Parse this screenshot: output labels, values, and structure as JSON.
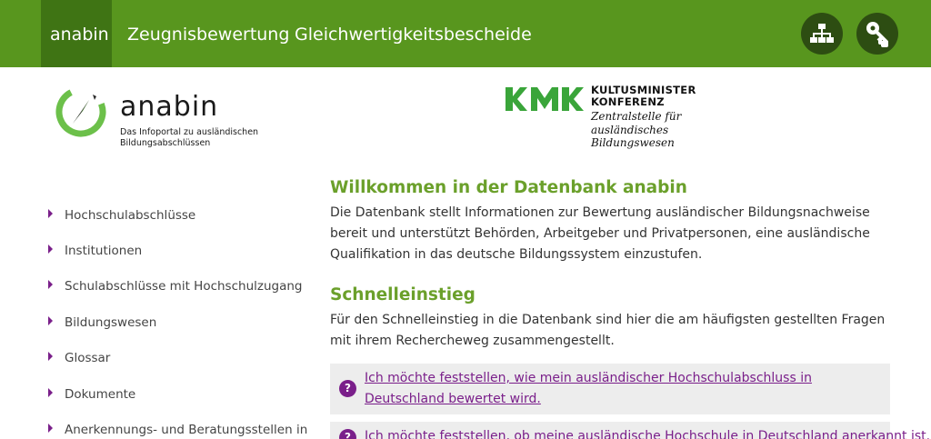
{
  "topnav": {
    "items": [
      "anabin",
      "Zeugnisbewertung",
      "Gleichwertigkeitsbescheide"
    ],
    "icons": [
      "sitemap-icon",
      "key-icon"
    ]
  },
  "logos": {
    "anabin": {
      "word": "anabin",
      "subtitle": "Das Infoportal zu ausländischen Bildungsabschlüssen"
    },
    "kmk": {
      "title": "KULTUSMINISTER KONFERENZ",
      "subtitle": "Zentralstelle für ausländisches Bildungswesen"
    }
  },
  "sidebar": {
    "items": [
      "Hochschulabschlüsse",
      "Institutionen",
      "Schulabschlüsse mit Hochschulzugang",
      "Bildungswesen",
      "Glossar",
      "Dokumente",
      "Anerkennungs- und Beratungsstellen in"
    ]
  },
  "main": {
    "welcome_heading": "Willkommen in der Datenbank anabin",
    "welcome_text": "Die Datenbank stellt Informationen zur Bewertung ausländischer Bildungsnachweise bereit und unterstützt Behörden, Arbeitgeber und Privatpersonen, eine ausländische Qualifikation in das deutsche Bildungssystem einzustufen.",
    "quick_heading": "Schnelleinstieg",
    "quick_text": "Für den Schnelleinstieg in die Datenbank sind hier die am häufigsten gestellten Fragen mit ihrem Rechercheweg zusammengestellt.",
    "faq": [
      "Ich möchte feststellen, wie mein ausländischer Hochschulabschluss in Deutschland bewertet wird.",
      "Ich möchte feststellen, ob meine ausländische Hochschule in Deutschland anerkannt ist."
    ],
    "faq_icon_glyph": "?"
  },
  "colors": {
    "topbar": "#58961e",
    "active_tab": "#3f7414",
    "heading_green": "#6ba02b",
    "link_purple": "#7a1f8a"
  }
}
